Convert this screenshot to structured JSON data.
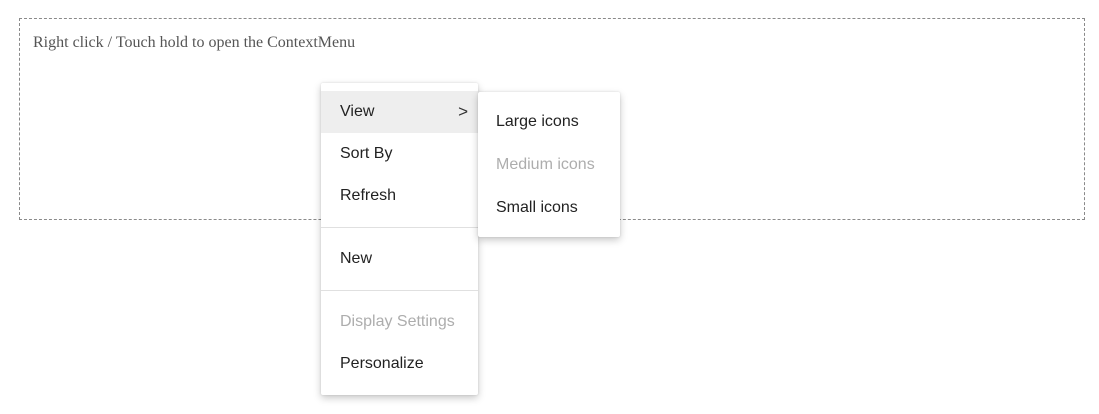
{
  "target_area": {
    "hint": "Right click / Touch hold to open the ContextMenu"
  },
  "context_menu": {
    "items": [
      {
        "label": "View",
        "has_submenu": true,
        "active": true,
        "disabled": false
      },
      {
        "label": "Sort By",
        "has_submenu": false,
        "active": false,
        "disabled": false
      },
      {
        "label": "Refresh",
        "has_submenu": false,
        "active": false,
        "disabled": false
      },
      {
        "label": "New",
        "has_submenu": false,
        "active": false,
        "disabled": false
      },
      {
        "label": "Display Settings",
        "has_submenu": false,
        "active": false,
        "disabled": true
      },
      {
        "label": "Personalize",
        "has_submenu": false,
        "active": false,
        "disabled": false
      }
    ],
    "submenu_glyph": ">",
    "view_submenu": {
      "items": [
        {
          "label": "Large icons",
          "disabled": false
        },
        {
          "label": "Medium icons",
          "disabled": true
        },
        {
          "label": "Small icons",
          "disabled": false
        }
      ]
    }
  },
  "icons": {
    "submenu_indicator": "chevron-right-icon"
  },
  "colors": {
    "active_background": "#eeeeee",
    "disabled_text": "#adadad",
    "text": "#222222",
    "border": "#8a8a8a"
  }
}
